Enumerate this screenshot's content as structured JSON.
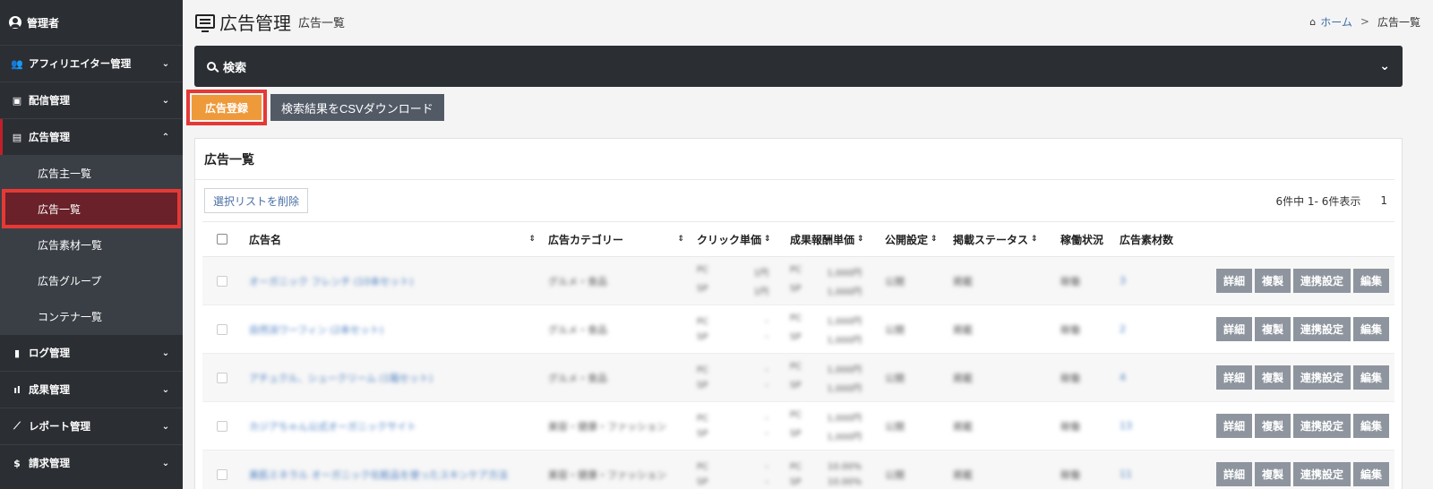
{
  "sidebar": {
    "user": "管理者",
    "items": [
      {
        "label": "アフィリエイター管理",
        "icon": "users-icon"
      },
      {
        "label": "配信管理",
        "icon": "delivery-icon"
      },
      {
        "label": "広告管理",
        "icon": "ad-icon",
        "expanded": true,
        "sub": [
          "広告主一覧",
          "広告一覧",
          "広告素材一覧",
          "広告グループ",
          "コンテナ一覧"
        ]
      },
      {
        "label": "ログ管理",
        "icon": "file-icon"
      },
      {
        "label": "成果管理",
        "icon": "bar-chart-icon"
      },
      {
        "label": "レポート管理",
        "icon": "line-chart-icon"
      },
      {
        "label": "請求管理",
        "icon": "dollar-icon"
      }
    ]
  },
  "header": {
    "title": "広告管理",
    "subtitle": "広告一覧",
    "breadcrumb_home": "ホーム",
    "breadcrumb_current": "広告一覧"
  },
  "search": {
    "label": "検索"
  },
  "buttons": {
    "register": "広告登録",
    "csv": "検索結果をCSVダウンロード"
  },
  "list": {
    "title": "広告一覧",
    "delete_label": "選択リストを削除",
    "count": "6件中 1- 6件表示",
    "page": "1",
    "columns": [
      "広告名",
      "広告カテゴリー",
      "クリック単価",
      "成果報酬単価",
      "公開設定",
      "掲載ステータス",
      "稼働状況",
      "広告素材数"
    ],
    "actions": [
      "詳細",
      "複製",
      "連携設定",
      "編集"
    ],
    "rows": [
      {
        "name": "オーガニック フレンチ (10本セット)",
        "category": "グルメ・食品",
        "click": [
          "PC",
          "SP"
        ],
        "click_val": [
          "1円",
          "1円"
        ],
        "reward": [
          "PC",
          "SP"
        ],
        "reward_val": [
          "1,000円",
          "1,000円"
        ],
        "pub": "公開",
        "status": "掲載",
        "work": "稼働",
        "mat": "3"
      },
      {
        "name": "自然派ワーフィン (2本セット)",
        "category": "グルメ・食品",
        "click": [
          "PC",
          "SP"
        ],
        "click_val": [
          "-",
          "-"
        ],
        "reward": [
          "PC",
          "SP"
        ],
        "reward_val": [
          "1,000円",
          "1,000円"
        ],
        "pub": "公開",
        "status": "掲載",
        "work": "稼働",
        "mat": "2"
      },
      {
        "name": "アチュクル、シュークリーム (1箱セット)",
        "category": "グルメ・食品",
        "click": [
          "PC",
          "SP"
        ],
        "click_val": [
          "-",
          "-"
        ],
        "reward": [
          "PC",
          "SP"
        ],
        "reward_val": [
          "1,000円",
          "1,000円"
        ],
        "pub": "公開",
        "status": "掲載",
        "work": "稼働",
        "mat": "4"
      },
      {
        "name": "カジアちゃん公式オーガニックサイト",
        "category": "美容・健康・ファッション",
        "click": [
          "PC",
          "SP"
        ],
        "click_val": [
          "-",
          "-"
        ],
        "reward": [
          "PC",
          "SP"
        ],
        "reward_val": [
          "1,000円",
          "1,000円"
        ],
        "pub": "公開",
        "status": "掲載",
        "work": "稼働",
        "mat": "13"
      },
      {
        "name": "美肌ミネラル オーガニック化粧品を使ったスキンケア方法",
        "category": "美容・健康・ファッション",
        "click": [
          "PC",
          "SP"
        ],
        "click_val": [
          "-",
          "-"
        ],
        "reward": [
          "PC",
          "SP"
        ],
        "reward_val": [
          "10.00%",
          "10.00%"
        ],
        "pub": "公開",
        "status": "掲載",
        "work": "稼働",
        "mat": "11"
      }
    ]
  }
}
